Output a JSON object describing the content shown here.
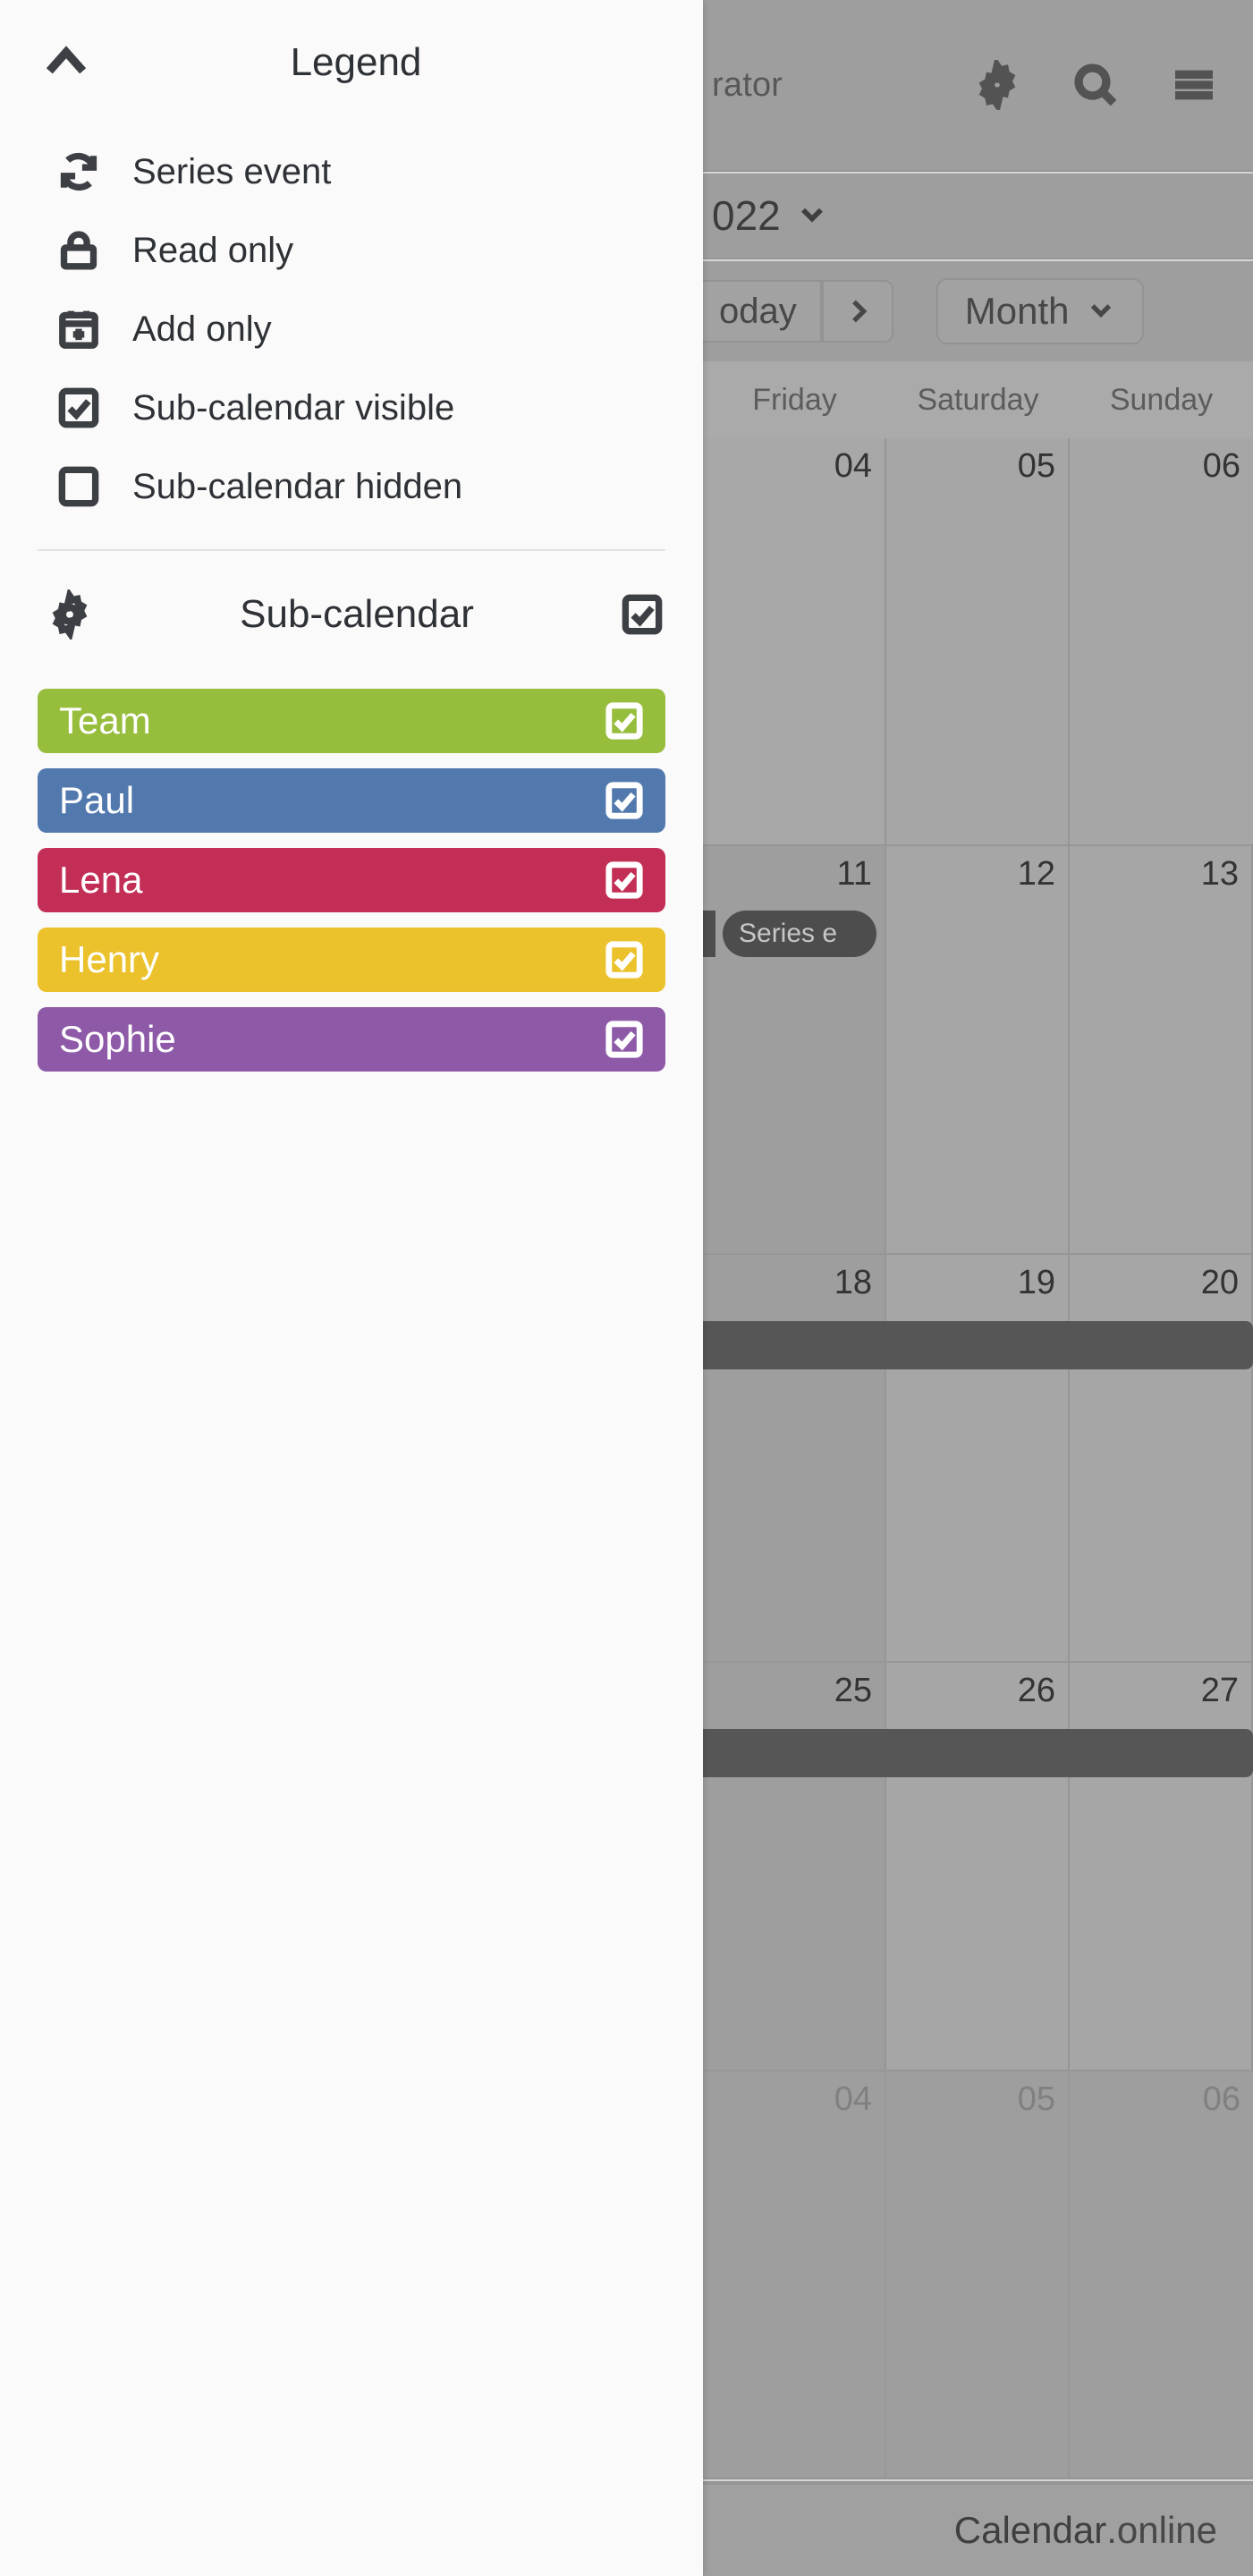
{
  "panel": {
    "collapse_icon": "chevron-up-icon",
    "title": "Legend",
    "legend_items": [
      {
        "icon": "series-event-icon",
        "label": "Series event"
      },
      {
        "icon": "lock-icon",
        "label": "Read only"
      },
      {
        "icon": "calendar-plus-icon",
        "label": "Add only"
      },
      {
        "icon": "checkbox-checked-icon",
        "label": "Sub-calendar visible"
      },
      {
        "icon": "checkbox-unchecked-icon",
        "label": "Sub-calendar hidden"
      }
    ],
    "subcalendar": {
      "gear_icon": "gear-icon",
      "title": "Sub-calendar",
      "select_all_icon": "checkbox-checked-icon",
      "items": [
        {
          "name": "Team",
          "color": "#97bd3d",
          "checked": true
        },
        {
          "name": "Paul",
          "color": "#5279ae",
          "checked": true
        },
        {
          "name": "Lena",
          "color": "#c32e56",
          "checked": true
        },
        {
          "name": "Henry",
          "color": "#ebc22c",
          "checked": true
        },
        {
          "name": "Sophie",
          "color": "#8e5aa8",
          "checked": true
        }
      ]
    }
  },
  "calendar": {
    "topbar": {
      "title": "rator",
      "icons": [
        "gear-icon",
        "search-icon",
        "hamburger-menu-icon"
      ]
    },
    "date_label": "022",
    "date_caret_icon": "chevron-down-icon",
    "toolbar": {
      "today_label": "oday",
      "next_icon": "chevron-right-icon",
      "view_label": "Month",
      "view_caret_icon": "chevron-down-icon"
    },
    "weekdays": [
      "Friday",
      "Saturday",
      "Sunday"
    ],
    "weeks": [
      {
        "days": [
          {
            "num": "04",
            "type": "today"
          },
          {
            "num": "05",
            "type": "weekend"
          },
          {
            "num": "06",
            "type": "weekend"
          }
        ]
      },
      {
        "days": [
          {
            "num": "11",
            "type": "plain"
          },
          {
            "num": "12",
            "type": "weekend"
          },
          {
            "num": "13",
            "type": "weekend"
          }
        ],
        "event_pill": {
          "label": "Series e",
          "color": "#9e2a4e"
        }
      },
      {
        "days": [
          {
            "num": "18",
            "type": "plain"
          },
          {
            "num": "19",
            "type": "weekend"
          },
          {
            "num": "20",
            "type": "weekend"
          }
        ],
        "event_bar": {
          "color": "#3a5480"
        }
      },
      {
        "days": [
          {
            "num": "25",
            "type": "plain"
          },
          {
            "num": "26",
            "type": "weekend"
          },
          {
            "num": "27",
            "type": "weekend"
          }
        ],
        "event_bar": {
          "color": "#3a5480"
        }
      },
      {
        "days": [
          {
            "num": "04",
            "type": "other"
          },
          {
            "num": "05",
            "type": "other"
          },
          {
            "num": "06",
            "type": "other"
          }
        ]
      }
    ],
    "footer": {
      "brand_main": "Calendar",
      "brand_tld": ".online"
    }
  }
}
